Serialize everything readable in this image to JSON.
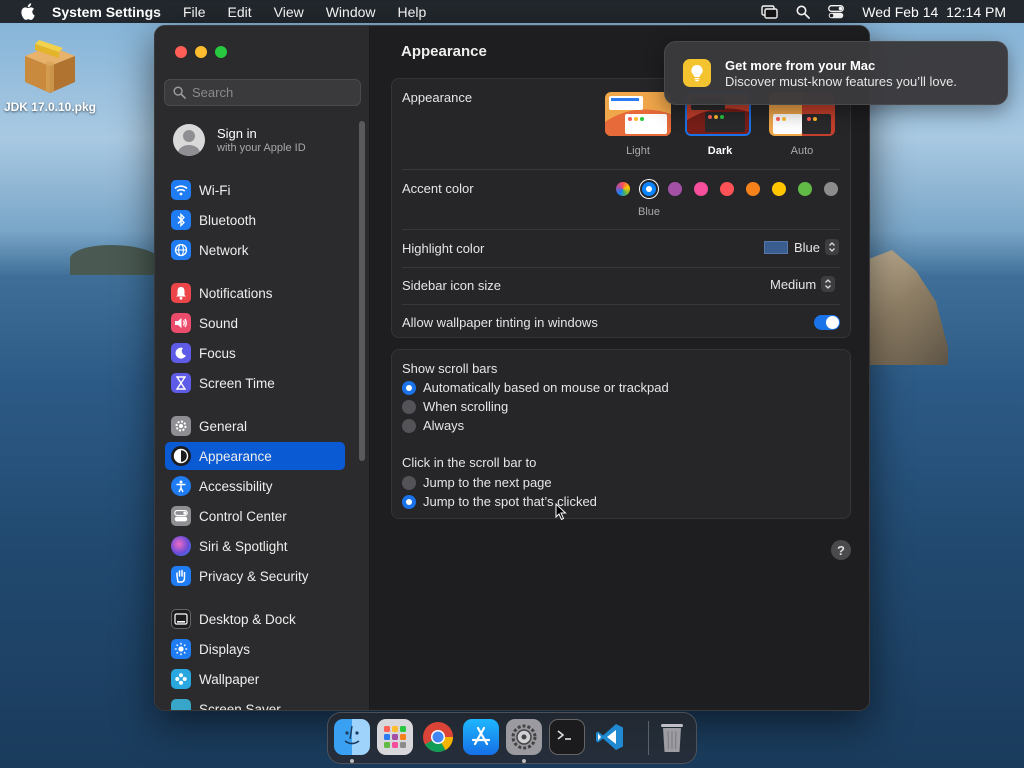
{
  "menubar": {
    "app_name": "System Settings",
    "menus": [
      "File",
      "Edit",
      "View",
      "Window",
      "Help"
    ],
    "clock": "Wed Feb 14  12:14 PM"
  },
  "desktop": {
    "icon_label": "JDK 17.0.10.pkg"
  },
  "sidebar": {
    "search_placeholder": "Search",
    "account": {
      "title": "Sign in",
      "subtitle": "with your Apple ID"
    },
    "items": [
      {
        "label": "Wi-Fi",
        "icon": "wifi-icon",
        "color": "#1f7cf2"
      },
      {
        "label": "Bluetooth",
        "icon": "bluetooth-icon",
        "color": "#1f7cf2"
      },
      {
        "label": "Network",
        "icon": "globe-icon",
        "color": "#1f7cf2"
      },
      {
        "label": "Notifications",
        "icon": "bell-icon",
        "color": "#ec4549"
      },
      {
        "label": "Sound",
        "icon": "speaker-icon",
        "color": "#ec4c6b"
      },
      {
        "label": "Focus",
        "icon": "moon-icon",
        "color": "#5e5ce6"
      },
      {
        "label": "Screen Time",
        "icon": "hourglass-icon",
        "color": "#5e5ce6"
      },
      {
        "label": "General",
        "icon": "gear-icon",
        "color": "#8e8e93"
      },
      {
        "label": "Appearance",
        "icon": "appearance-icon",
        "color": "#1c1c1e"
      },
      {
        "label": "Accessibility",
        "icon": "accessibility-icon",
        "color": "#1f7cf2"
      },
      {
        "label": "Control Center",
        "icon": "control-center-icon",
        "color": "#8e8e93"
      },
      {
        "label": "Siri & Spotlight",
        "icon": "siri-icon",
        "color": "#a050d8"
      },
      {
        "label": "Privacy & Security",
        "icon": "hand-icon",
        "color": "#1f7cf2"
      },
      {
        "label": "Desktop & Dock",
        "icon": "dock-icon",
        "color": "#1c1c1e"
      },
      {
        "label": "Displays",
        "icon": "sun-icon",
        "color": "#1f7cf2"
      },
      {
        "label": "Wallpaper",
        "icon": "flower-icon",
        "color": "#29a8e0"
      },
      {
        "label": "Screen Saver",
        "icon": "screensaver-icon",
        "color": "#37a6c8"
      }
    ],
    "active": "Appearance"
  },
  "main": {
    "title": "Appearance",
    "appearance": {
      "label": "Appearance",
      "options": [
        "Light",
        "Dark",
        "Auto"
      ],
      "selected": "Dark"
    },
    "accent": {
      "label": "Accent color",
      "colors": [
        "multicolor",
        "#0a84ff",
        "#a550a7",
        "#f74f9e",
        "#ff5257",
        "#f7821b",
        "#ffc600",
        "#62ba46",
        "#8c8c8c"
      ],
      "selected_name": "Blue"
    },
    "highlight": {
      "label": "Highlight color",
      "value": "Blue",
      "swatch": "#3a5d8f"
    },
    "icon_size": {
      "label": "Sidebar icon size",
      "value": "Medium"
    },
    "tinting": {
      "label": "Allow wallpaper tinting in windows",
      "enabled": true
    },
    "scrollbars": {
      "label": "Show scroll bars",
      "options": [
        "Automatically based on mouse or trackpad",
        "When scrolling",
        "Always"
      ],
      "selected": 0
    },
    "click_scroll": {
      "label": "Click in the scroll bar to",
      "options": [
        "Jump to the next page",
        "Jump to the spot that’s clicked"
      ],
      "selected": 1
    },
    "help": "?"
  },
  "notification": {
    "title": "Get more from your Mac",
    "body": "Discover must-know features you’ll love."
  },
  "dock": [
    "Finder",
    "Launchpad",
    "Chrome",
    "App Store",
    "System Settings",
    "Terminal",
    "VS Code",
    "Trash"
  ]
}
